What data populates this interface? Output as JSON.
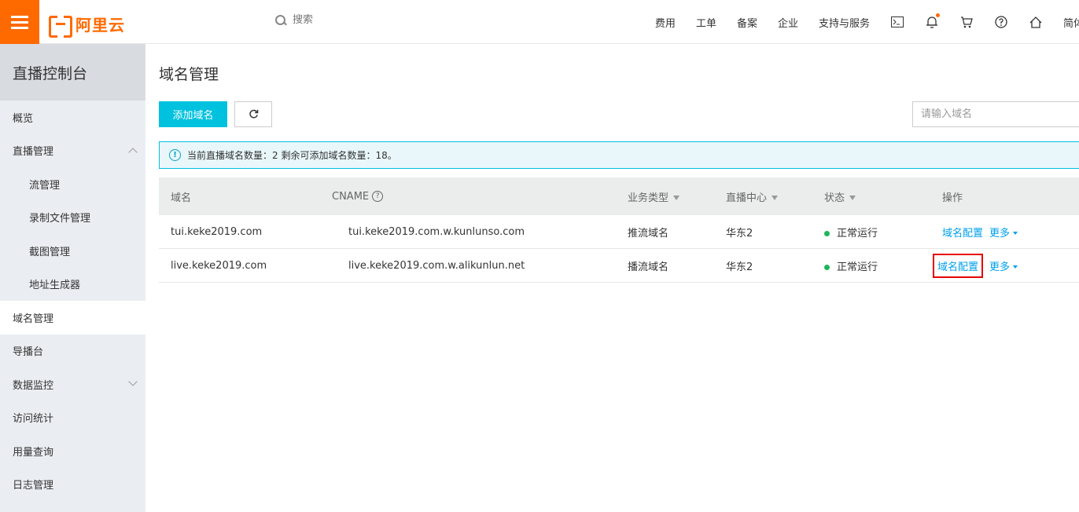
{
  "topbar": {
    "logo_text": "阿里云",
    "search_placeholder": "搜索",
    "nav": [
      "费用",
      "工单",
      "备案",
      "企业",
      "支持与服务"
    ],
    "lang": "简体"
  },
  "sidebar": {
    "title": "直播控制台",
    "items": [
      {
        "label": "概览"
      },
      {
        "label": "直播管理"
      },
      {
        "label": "流管理"
      },
      {
        "label": "录制文件管理"
      },
      {
        "label": "截图管理"
      },
      {
        "label": "地址生成器"
      },
      {
        "label": "域名管理"
      },
      {
        "label": "导播台"
      },
      {
        "label": "数据监控"
      },
      {
        "label": "访问统计"
      },
      {
        "label": "用量查询"
      },
      {
        "label": "日志管理"
      }
    ]
  },
  "main": {
    "title": "域名管理",
    "add_button": "添加域名",
    "filter_placeholder": "请输入域名",
    "notice": "当前直播域名数量：2 剩余可添加域名数量：18。"
  },
  "table": {
    "headers": {
      "domain": "域名",
      "cname": "CNAME",
      "type": "业务类型",
      "center": "直播中心",
      "status": "状态",
      "op": "操作"
    },
    "rows": [
      {
        "domain": "tui.keke2019.com",
        "cname": "tui.keke2019.com.w.kunlunso.com",
        "type": "推流域名",
        "center": "华东2",
        "status": "正常运行",
        "config": "域名配置",
        "more": "更多"
      },
      {
        "domain": "live.keke2019.com",
        "cname": "live.keke2019.com.w.alikunlun.net",
        "type": "播流域名",
        "center": "华东2",
        "status": "正常运行",
        "config": "域名配置",
        "more": "更多"
      }
    ]
  },
  "colors": {
    "brand": "#ff6a00",
    "primary": "#00c1de",
    "link": "#00a0e9",
    "status_ok": "#1db65a",
    "highlight": "#e60000"
  }
}
